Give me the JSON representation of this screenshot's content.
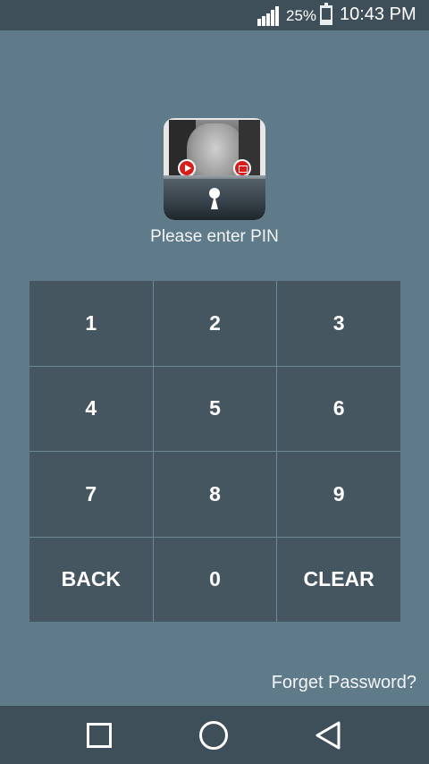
{
  "status_bar": {
    "battery_percent": "25%",
    "battery_level": 0.25,
    "time": "10:43 PM",
    "icons": [
      "signal-icon",
      "battery-icon"
    ]
  },
  "lock_screen": {
    "prompt": "Please enter PIN",
    "keys": [
      "1",
      "2",
      "3",
      "4",
      "5",
      "6",
      "7",
      "8",
      "9",
      "BACK",
      "0",
      "CLEAR"
    ],
    "forget_password": "Forget Password?"
  },
  "nav_bar": {
    "icons": [
      "recent-apps-icon",
      "home-icon",
      "back-icon"
    ]
  }
}
